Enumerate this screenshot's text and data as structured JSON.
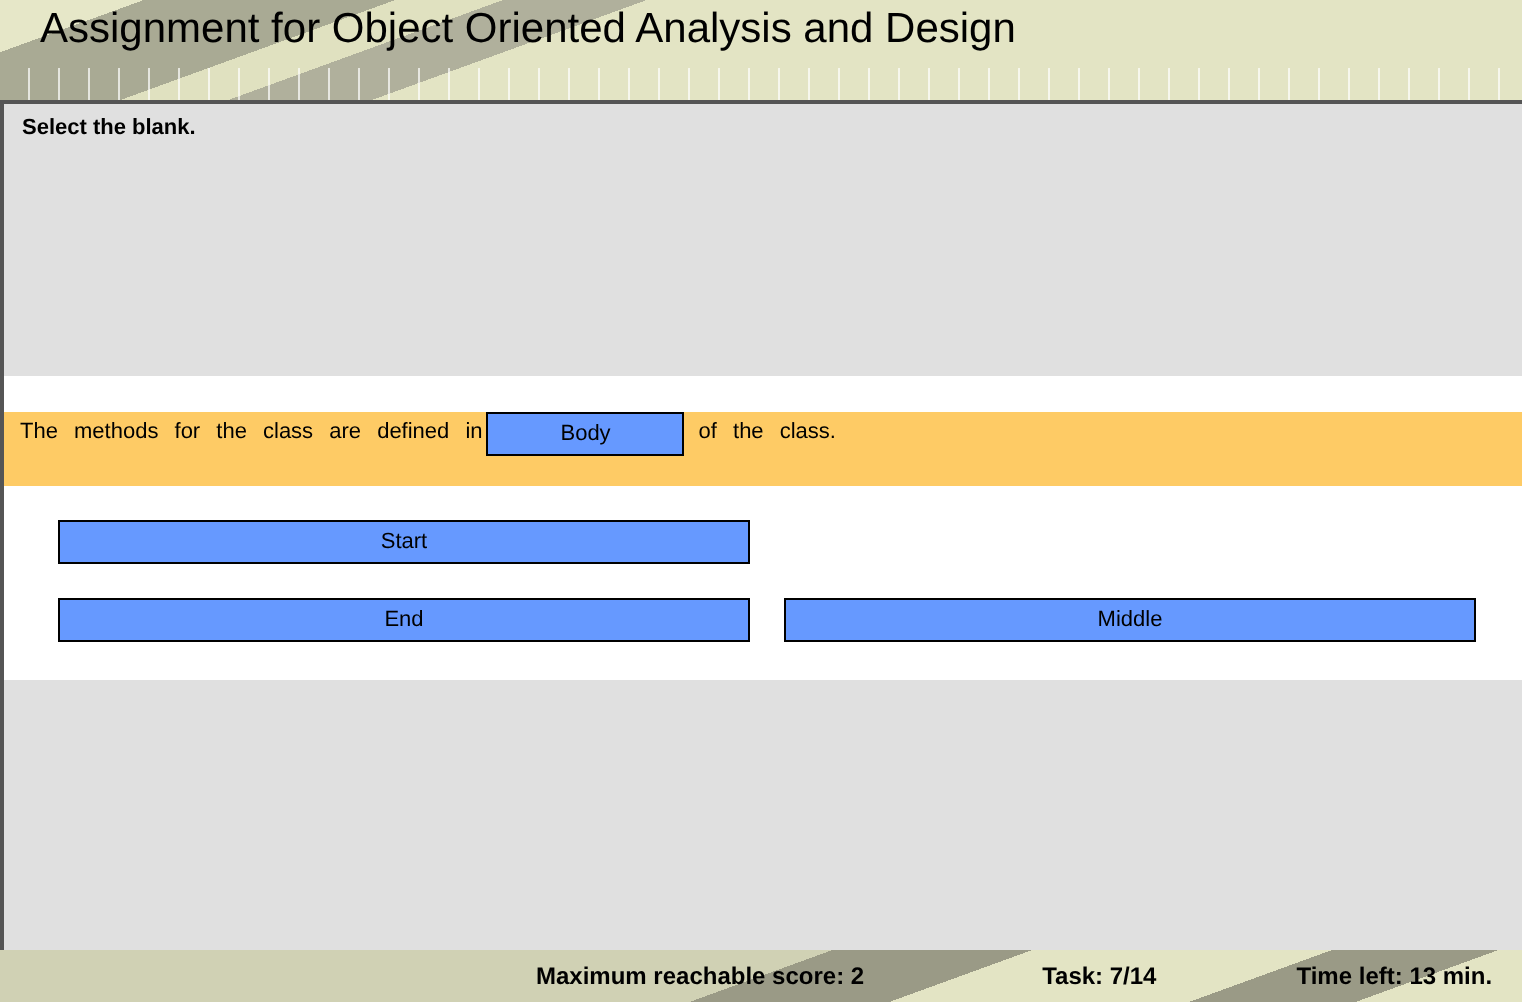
{
  "header": {
    "title": "Assignment for Object Oriented Analysis and Design"
  },
  "task": {
    "instruction": "Select the blank.",
    "sentence_before": "The methods for the class are defined in",
    "blank": "Body",
    "sentence_after": "of the class."
  },
  "options": [
    {
      "label": "Start"
    },
    {
      "label": "End"
    },
    {
      "label": "Middle"
    }
  ],
  "status_bar": {
    "max_score": "Maximum reachable score: 2",
    "task": "Task: 7/14",
    "time_left": "Time left: 13 min."
  }
}
